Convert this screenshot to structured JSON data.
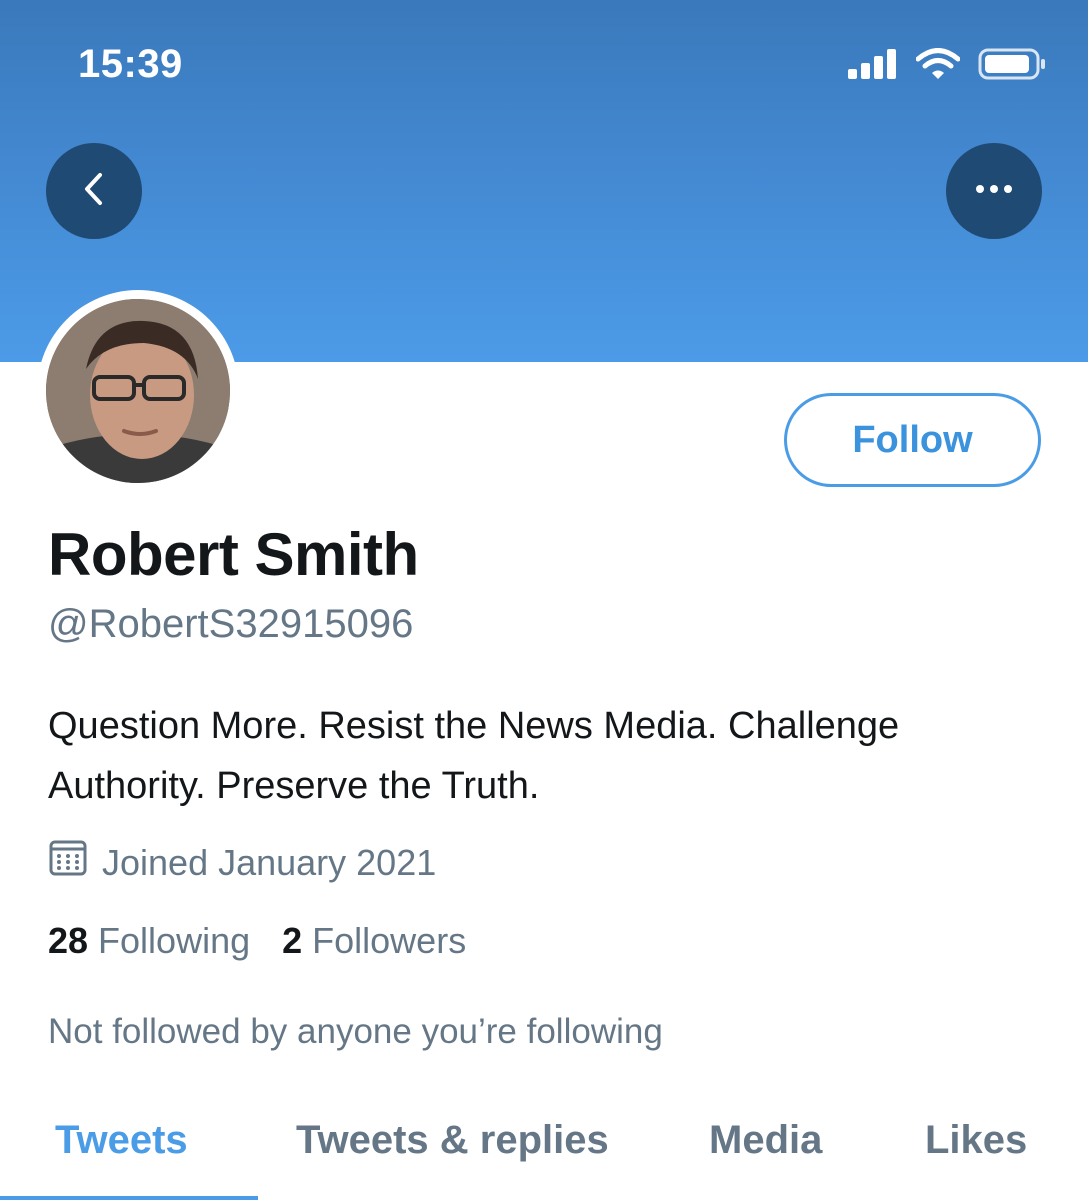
{
  "status_bar": {
    "time": "15:39"
  },
  "colors": {
    "accent": "#4a9ce6",
    "banner": "#448ad3",
    "nav_button": "#1f4a73",
    "secondary_text": "#657786"
  },
  "profile": {
    "name": "Robert Smith",
    "handle": "@RobertS32915096",
    "bio": "Question More. Resist the News Media. Challenge Authority. Preserve the Truth.",
    "joined": "Joined January 2021",
    "following_count": "28",
    "following_label": "Following",
    "followers_count": "2",
    "followers_label": "Followers",
    "mutuals": "Not followed by anyone you’re following"
  },
  "actions": {
    "follow_label": "Follow"
  },
  "tabs": [
    {
      "label": "Tweets",
      "active": true
    },
    {
      "label": "Tweets & replies",
      "active": false
    },
    {
      "label": "Media",
      "active": false
    },
    {
      "label": "Likes",
      "active": false
    }
  ]
}
